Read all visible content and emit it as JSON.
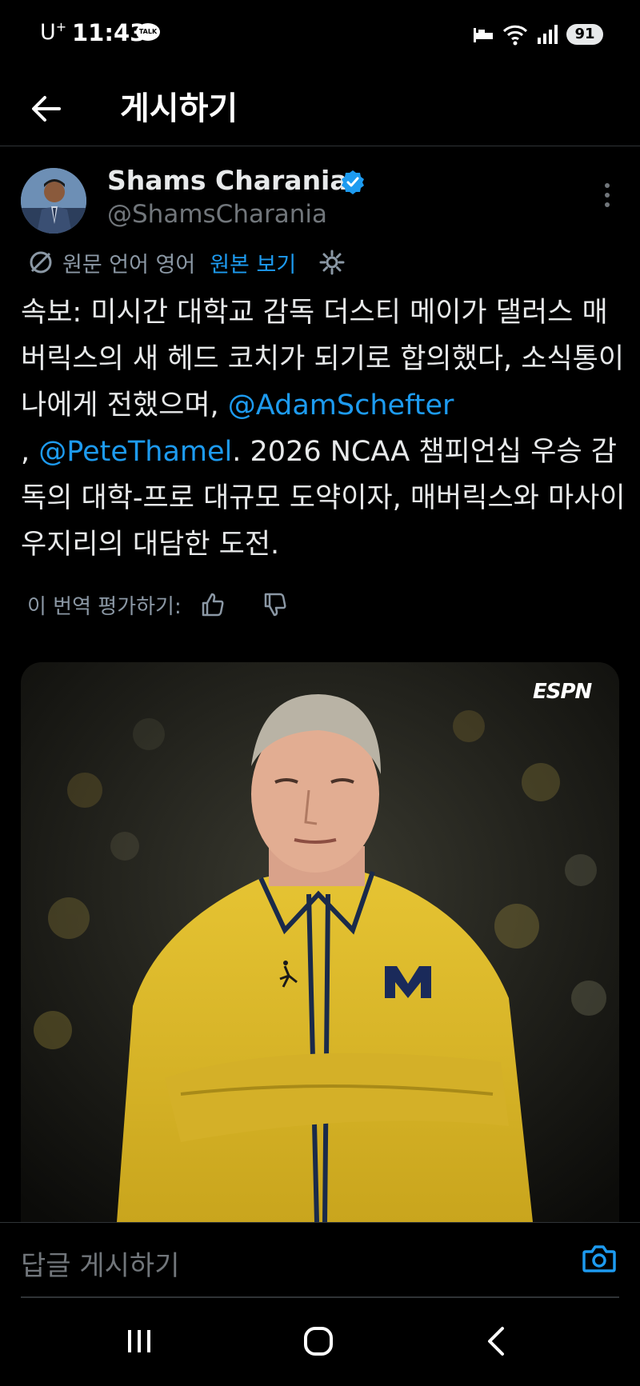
{
  "status_bar": {
    "carrier": "U",
    "carrier_sup": "+",
    "time": "11:43",
    "talk_badge": "TALK",
    "battery": "91",
    "icons": [
      "bed-icon",
      "wifi-icon",
      "signal-icon",
      "battery-icon"
    ]
  },
  "header": {
    "title": "게시하기",
    "back_icon": "arrow-left-icon"
  },
  "post": {
    "author_name": "Shams Charania",
    "author_handle": "@ShamsCharania",
    "verified": true,
    "translation": {
      "label": "원문 언어 영어",
      "show_original": "원본 보기"
    },
    "text_parts": {
      "p1": "속보: 미시간 대학교 감독 더스티 메이가 댈러스 매버릭스의 새 헤드 코치가 되기로 합의했다, 소식통이 나에게 전했으며, ",
      "mention1": "@AdamSchefter",
      "p2": "\n, ",
      "mention2": "@PeteThamel",
      "p3": ". 2026 NCAA 챔피언십 우승 감독의 대학-프로 대규모 도약이자, 매버릭스와 마사이 우지리의 대담한 도전."
    },
    "rate_label": "이 번역 평가하기:",
    "media": {
      "watermark": "ESPN",
      "description_icons": [
        "michigan-logo-icon",
        "jordan-logo-icon"
      ]
    }
  },
  "reply": {
    "placeholder": "답글 게시하기"
  },
  "colors": {
    "accent": "#1d9bf0",
    "background": "#000000",
    "text": "#e7e9ea",
    "muted": "#71767b"
  }
}
